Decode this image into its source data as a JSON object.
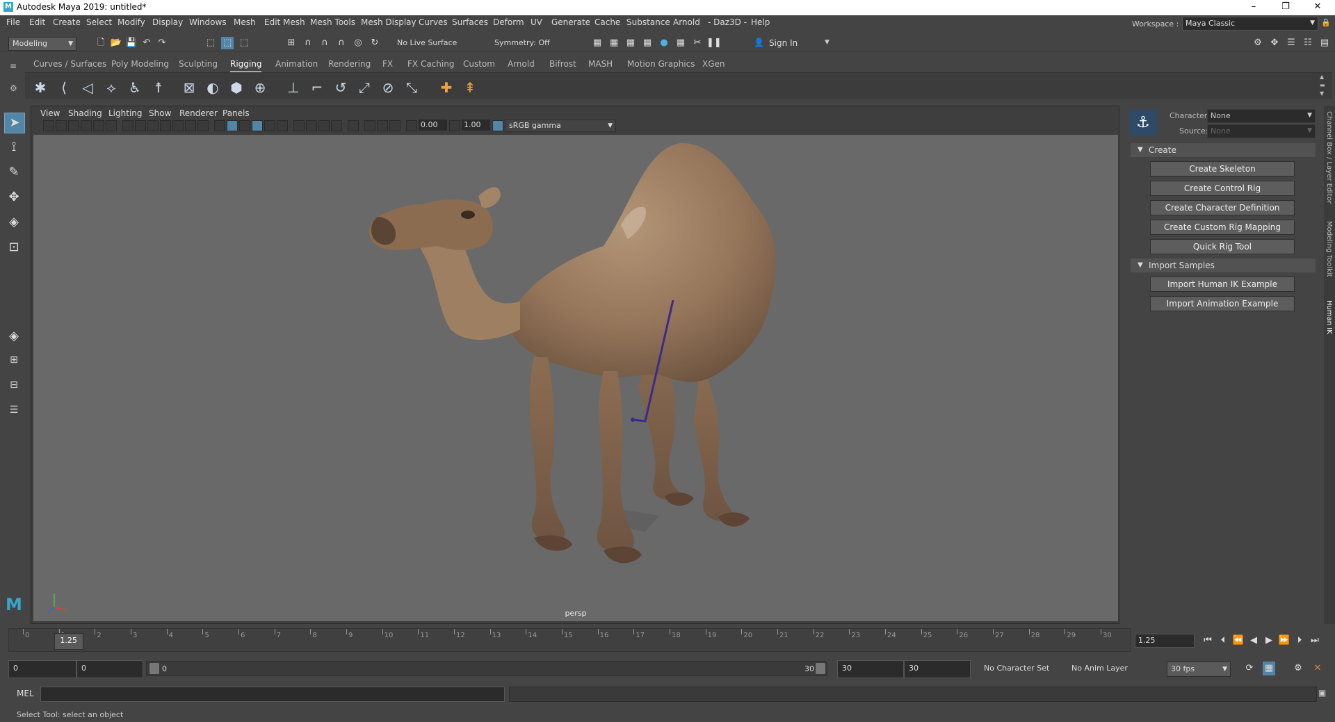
{
  "window": {
    "title": "Autodesk Maya 2019: untitled*",
    "minimize": "–",
    "restore": "❐",
    "close": "✕"
  },
  "menubar": {
    "items": [
      "File",
      "Edit",
      "Create",
      "Select",
      "Modify",
      "Display",
      "Windows",
      "Mesh",
      "Edit Mesh",
      "Mesh Tools",
      "Mesh Display",
      "Curves",
      "Surfaces",
      "Deform",
      "UV",
      "Generate",
      "Cache",
      "Substance",
      "Arnold",
      "- Daz3D -",
      "Help"
    ],
    "workspace_label": "Workspace :",
    "workspace_value": "Maya Classic"
  },
  "statusline": {
    "menuset": "Modeling",
    "live_surface": "No Live Surface",
    "symmetry": "Symmetry: Off",
    "sign_in": "Sign In"
  },
  "shelf": {
    "tabs": [
      "Curves / Surfaces",
      "Poly Modeling",
      "Sculpting",
      "Rigging",
      "Animation",
      "Rendering",
      "FX",
      "FX Caching",
      "Custom",
      "Arnold",
      "Bifrost",
      "MASH",
      "Motion Graphics",
      "XGen"
    ],
    "active_tab": "Rigging"
  },
  "panel": {
    "menus": [
      "View",
      "Shading",
      "Lighting",
      "Show",
      "Renderer",
      "Panels"
    ],
    "exposure": "0.00",
    "gamma": "1.00",
    "color_space": "sRGB gamma",
    "camera": "persp"
  },
  "humanik": {
    "character_label": "Character:",
    "character_value": "None",
    "source_label": "Source:",
    "source_value": "None",
    "create_header": "Create",
    "create_buttons": [
      "Create Skeleton",
      "Create Control Rig",
      "Create Character Definition",
      "Create Custom Rig Mapping",
      "Quick Rig Tool"
    ],
    "import_header": "Import Samples",
    "import_buttons": [
      "Import Human IK Example",
      "Import Animation Example"
    ]
  },
  "side_tabs": [
    "Channel Box / Layer Editor",
    "Modeling Toolkit",
    "Human IK"
  ],
  "timeline": {
    "ticks": [
      "0",
      "1",
      "2",
      "3",
      "4",
      "5",
      "6",
      "7",
      "8",
      "9",
      "10",
      "11",
      "12",
      "13",
      "14",
      "15",
      "16",
      "17",
      "18",
      "19",
      "20",
      "21",
      "22",
      "23",
      "24",
      "25",
      "26",
      "27",
      "28",
      "29",
      "30"
    ],
    "current_frame": "1.25",
    "current_frame_field": "1.25",
    "start": "0",
    "playback_start": "0",
    "range_start": "0",
    "range_end": "30",
    "playback_end": "30",
    "end": "30",
    "character_set": "No Character Set",
    "anim_layer": "No Anim Layer",
    "fps": "30 fps"
  },
  "command": {
    "mel": "MEL"
  },
  "help_line": "Select Tool: select an object"
}
